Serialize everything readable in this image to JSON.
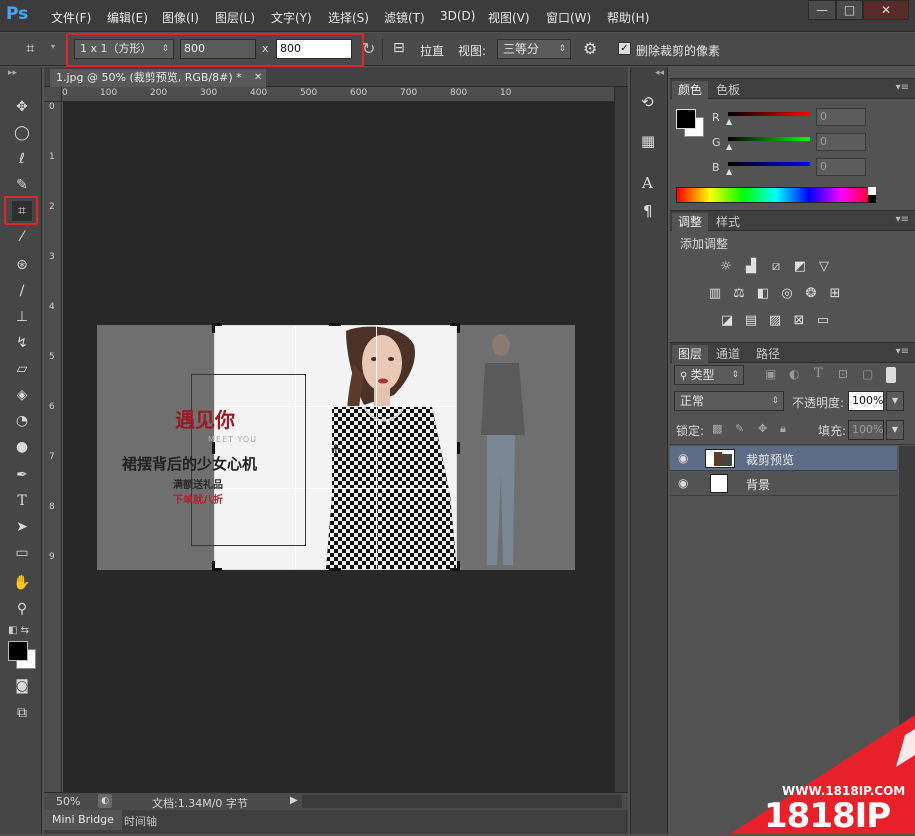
{
  "app": {
    "logo": "Ps"
  },
  "menu": [
    "文件(F)",
    "编辑(E)",
    "图像(I)",
    "图层(L)",
    "文字(Y)",
    "选择(S)",
    "滤镜(T)",
    "3D(D)",
    "视图(V)",
    "窗口(W)",
    "帮助(H)"
  ],
  "window_controls": {
    "minimize": "—",
    "maximize": "□",
    "close": "✕"
  },
  "options": {
    "ratio_select": "1 x 1（方形）",
    "width_value": "800",
    "times": "x",
    "height_value": "800",
    "straighten_label": "拉直",
    "view_label": "视图:",
    "view_select": "三等分",
    "delete_pixels_label": "删除裁剪的像素",
    "delete_pixels_checked": true
  },
  "document": {
    "tab_title": "1.jpg @ 50% (裁剪预览, RGB/8#) *",
    "ruler_h": [
      "0",
      "100",
      "200",
      "300",
      "400",
      "500",
      "600",
      "700",
      "800",
      "10"
    ],
    "ruler_v": [
      "0",
      "1",
      "2",
      "3",
      "4",
      "5",
      "6",
      "7",
      "8",
      "9"
    ],
    "image_text": {
      "headline": "遇见你",
      "sub": "MEET YOU",
      "slogan": "裙摆背后的少女心机",
      "line1": "满额送礼品",
      "line2": "下单就八折"
    }
  },
  "status": {
    "zoom": "50%",
    "doc_info": "文档:1.34M/0 字节"
  },
  "bottom_tabs": [
    "Mini Bridge",
    "时间轴"
  ],
  "color_panel": {
    "tabs": [
      "颜色",
      "色板"
    ],
    "channels": [
      {
        "label": "R",
        "value": "0"
      },
      {
        "label": "G",
        "value": "0"
      },
      {
        "label": "B",
        "value": "0"
      }
    ]
  },
  "adjust_panel": {
    "tabs": [
      "调整",
      "样式"
    ],
    "title": "添加调整"
  },
  "layers_panel": {
    "tabs": [
      "图层",
      "通道",
      "路径"
    ],
    "filter_select": "类型",
    "blend_mode": "正常",
    "opacity_label": "不透明度:",
    "opacity_value": "100%",
    "lock_label": "锁定:",
    "fill_label": "填充:",
    "fill_value": "100%",
    "layers": [
      {
        "name": "裁剪预览",
        "selected": true
      },
      {
        "name": "背景",
        "selected": false
      }
    ]
  },
  "watermark": {
    "url": "WWW.1818IP.COM",
    "brand": "1818IP"
  },
  "colors": {
    "accent_red": "#d8262a",
    "ps_blue": "#4aa3ff",
    "selected_layer": "#5d6d86"
  }
}
